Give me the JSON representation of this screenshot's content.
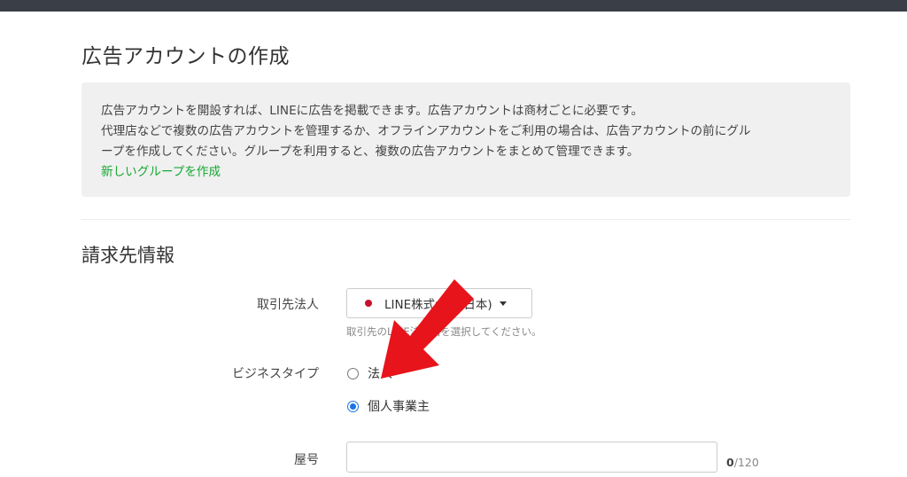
{
  "page": {
    "title": "広告アカウントの作成"
  },
  "info": {
    "line1": "広告アカウントを開設すれば、LINEに広告を掲載できます。広告アカウントは商材ごとに必要です。",
    "line2": "代理店などで複数の広告アカウントを管理するか、オフラインアカウントをご利用の場合は、広告アカウントの前にグル",
    "line3": "ープを作成してください。グループを利用すると、複数の広告アカウントをまとめて管理できます。",
    "link": "新しいグループを作成"
  },
  "billing": {
    "section_title": "請求先情報",
    "partner_label": "取引先法人",
    "partner_value": "LINE株式会社(日本)",
    "partner_help": "取引先のLINE法人国を選択してください。",
    "business_type_label": "ビジネスタイプ",
    "business_type_options": [
      {
        "label": "法人",
        "selected": false
      },
      {
        "label": "個人事業主",
        "selected": true
      }
    ],
    "trade_name_label": "屋号",
    "trade_name_value": "",
    "char_count_current": "0",
    "char_count_max": "/120"
  },
  "colors": {
    "accent_link": "#17a834",
    "radio_selected": "#1a73e8",
    "partner_dot": "#c8102e",
    "annotation_arrow": "#e8141b"
  },
  "annotation": {
    "icon": "red-arrow-icon"
  }
}
